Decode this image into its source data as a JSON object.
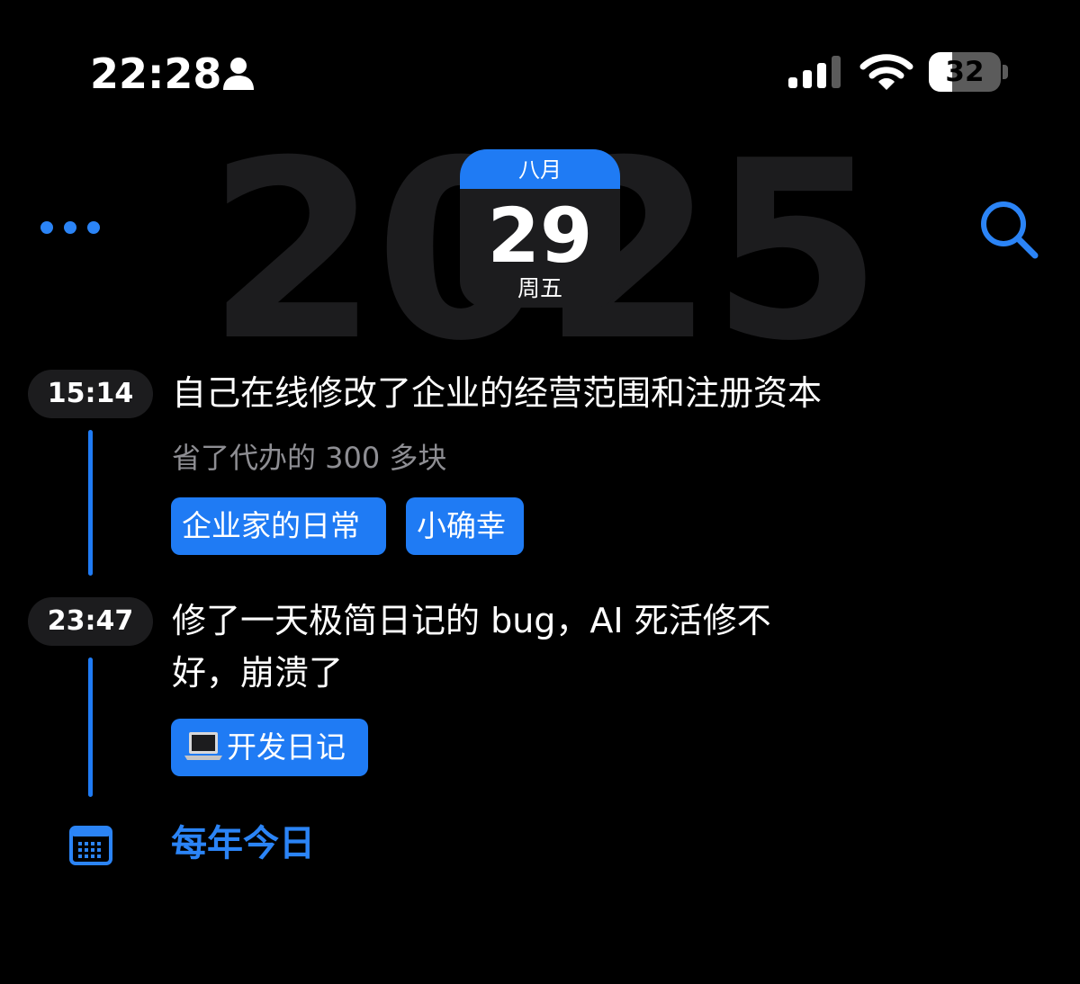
{
  "status_bar": {
    "time": "22:28",
    "battery_level": "32",
    "battery_fraction": 0.32,
    "icons": [
      "person-icon",
      "signal-icon",
      "wifi-icon",
      "battery-icon"
    ]
  },
  "header": {
    "year": "2025",
    "date_card": {
      "month": "八月",
      "day": "29",
      "weekday": "周五"
    },
    "icons": [
      "more-icon",
      "search-icon"
    ]
  },
  "entries": [
    {
      "time": "15:14",
      "title": "自己在线修改了企业的经营范围和注册资本",
      "subtitle": "省了代办的 300 多块",
      "tags": [
        "企业家的日常",
        "小确幸"
      ]
    },
    {
      "time": "23:47",
      "title_line1": "修了一天极简日记的 bug，AI 死活修不",
      "title_line2": "好，崩溃了",
      "tags": [
        "开发日记"
      ],
      "tag_icon": "laptop-icon"
    }
  ],
  "footer": {
    "label": "每年今日",
    "icon": "calendar-icon"
  },
  "colors": {
    "background": "#000000",
    "accent": "#1f7bf4",
    "card": "#1c1c1e",
    "secondary_text": "#8e8e93",
    "year_watermark": "#1c1c1e"
  }
}
